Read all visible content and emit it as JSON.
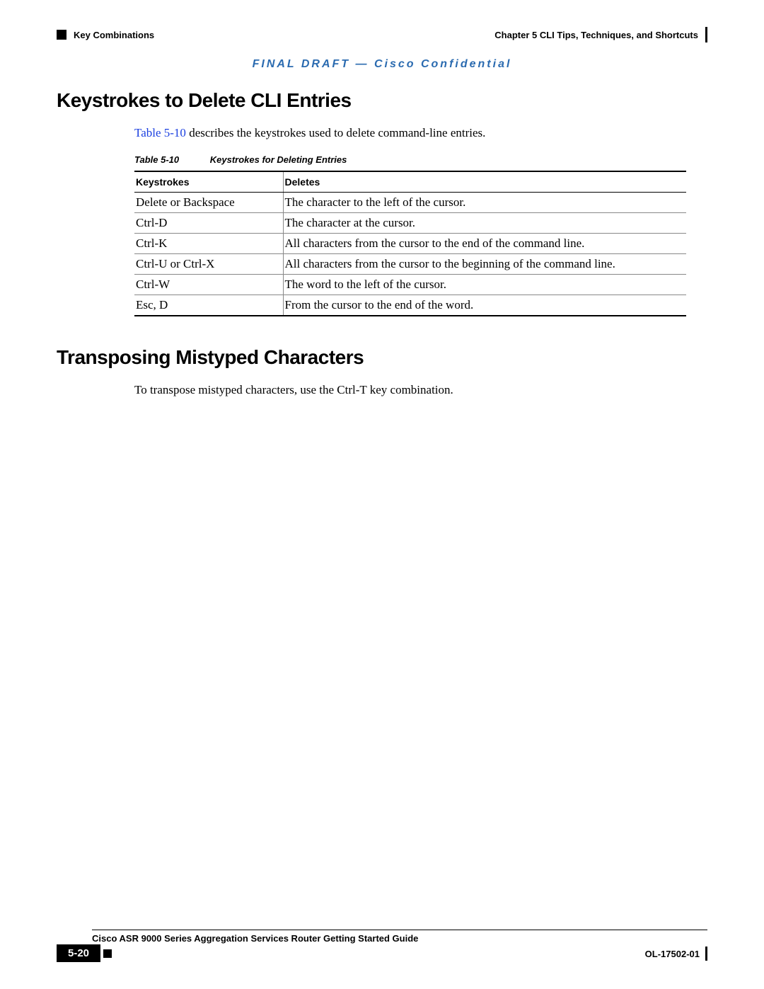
{
  "header": {
    "section_left": "Key Combinations",
    "chapter_right": "Chapter 5    CLI Tips, Techniques, and Shortcuts"
  },
  "draft_notice": "FINAL DRAFT — Cisco Confidential",
  "section1": {
    "title": "Keystrokes to Delete CLI Entries",
    "intro_link": "Table 5-10",
    "intro_rest": " describes the keystrokes used to delete command-line entries.",
    "table_label": "Table 5-10",
    "table_title": "Keystrokes for Deleting Entries",
    "col1_header": "Keystrokes",
    "col2_header": "Deletes",
    "rows": [
      {
        "k": "Delete or Backspace",
        "d": "The character to the left of the cursor."
      },
      {
        "k": "Ctrl-D",
        "d": "The character at the cursor."
      },
      {
        "k": "Ctrl-K",
        "d": "All characters from the cursor to the end of the command line."
      },
      {
        "k": "Ctrl-U or Ctrl-X",
        "d": "All characters from the cursor to the beginning of the command line."
      },
      {
        "k": "Ctrl-W",
        "d": "The word to the left of the cursor."
      },
      {
        "k": "Esc, D",
        "d": "From the cursor to the end of the word."
      }
    ]
  },
  "section2": {
    "title": "Transposing Mistyped Characters",
    "body": "To transpose mistyped characters, use the Ctrl-T key combination."
  },
  "footer": {
    "doc_title": "Cisco ASR 9000 Series Aggregation Services Router Getting Started Guide",
    "page_number": "5-20",
    "doc_id": "OL-17502-01"
  }
}
